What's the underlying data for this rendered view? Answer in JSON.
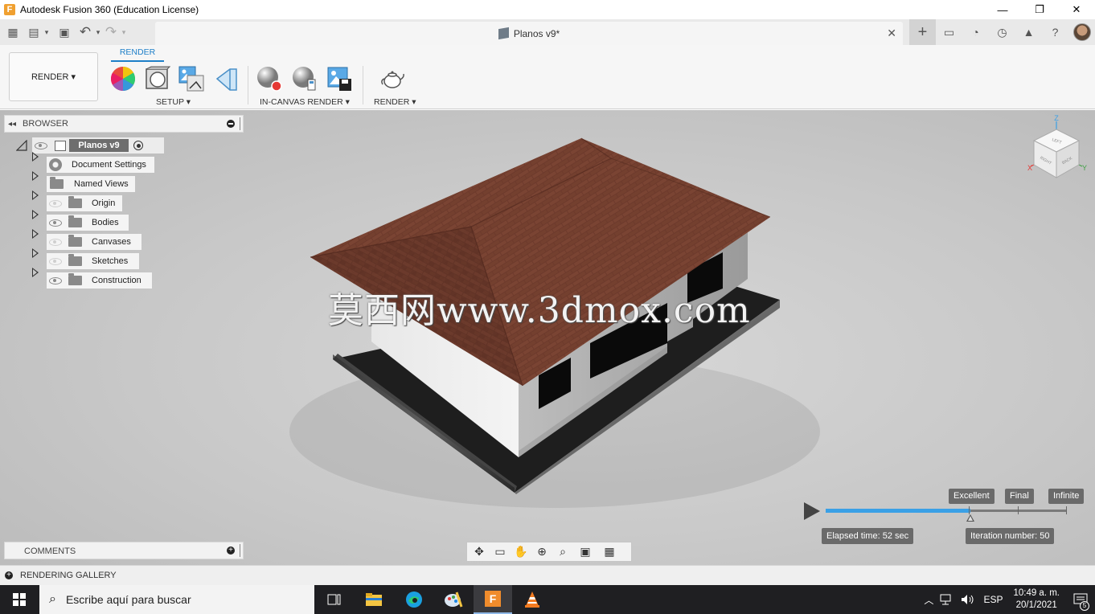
{
  "window": {
    "title": "Autodesk Fusion 360 (Education License)",
    "logo_letter": "F",
    "minimize_glyph": "—",
    "restore_glyph": "❐",
    "close_glyph": "✕"
  },
  "quick_access": {
    "grid_glyph": "▦",
    "file_glyph": "▤",
    "save_glyph": "▣",
    "undo_glyph": "↶",
    "redo_glyph": "↷",
    "dropdown_glyph": "▾"
  },
  "document_tab": {
    "label": "Planos v9*",
    "close_glyph": "✕"
  },
  "top_right": {
    "plus_glyph": "+",
    "chat_glyph": "▭",
    "sync_glyph": "◔",
    "history_glyph": "◷",
    "notify_glyph": "▲",
    "help_glyph": "?"
  },
  "ribbon": {
    "workspace": "RENDER ▾",
    "active_tab": "RENDER",
    "groups": {
      "setup": "SETUP ▾",
      "in_canvas": "IN-CANVAS RENDER ▾",
      "render": "RENDER ▾"
    }
  },
  "browser": {
    "collapse_glyph": "◂◂",
    "title": "BROWSER",
    "root": "Planos v9",
    "items": [
      {
        "label": "Document Settings",
        "icon": "gear-icon"
      },
      {
        "label": "Named Views",
        "icon": "folder-icon"
      },
      {
        "label": "Origin",
        "icon": "folder-icon",
        "visible": false
      },
      {
        "label": "Bodies",
        "icon": "folder-icon",
        "visible": true
      },
      {
        "label": "Canvases",
        "icon": "folder-icon",
        "visible": false
      },
      {
        "label": "Sketches",
        "icon": "folder-icon",
        "visible": false
      },
      {
        "label": "Construction",
        "icon": "folder-icon",
        "visible": true
      }
    ]
  },
  "viewcube": {
    "z": "Z",
    "x": "X",
    "y": "Y",
    "top": "LEFT",
    "right": "RIGHT",
    "back": "BACK"
  },
  "watermark": "莫西网www.3dmox.com",
  "render_progress": {
    "quality_levels": [
      "Excellent",
      "Final",
      "Infinite"
    ],
    "elapsed": "Elapsed time: 52 sec",
    "iteration": "Iteration number: 50",
    "fraction": 0.6
  },
  "comments": {
    "title": "COMMENTS",
    "plus_glyph": "+"
  },
  "gallery": {
    "title": "RENDERING GALLERY",
    "plus_glyph": "+"
  },
  "nav_toolbar": {
    "orbit_glyph": "✥",
    "lookat_glyph": "▭",
    "pan_glyph": "✋",
    "zoom_glyph": "⊕",
    "fit_glyph": "⌕",
    "display_glyph": "▣",
    "grid_glyph": "▦"
  },
  "taskbar": {
    "search_icon": "⌕",
    "search_placeholder": "Escribe aquí para buscar",
    "tray_up": "︿",
    "language": "ESP",
    "time": "10:49 a. m.",
    "date": "20/1/2021",
    "notifications": "5",
    "colors": {
      "accent": "#8fb8e6",
      "bg": "#1f1f22"
    }
  }
}
